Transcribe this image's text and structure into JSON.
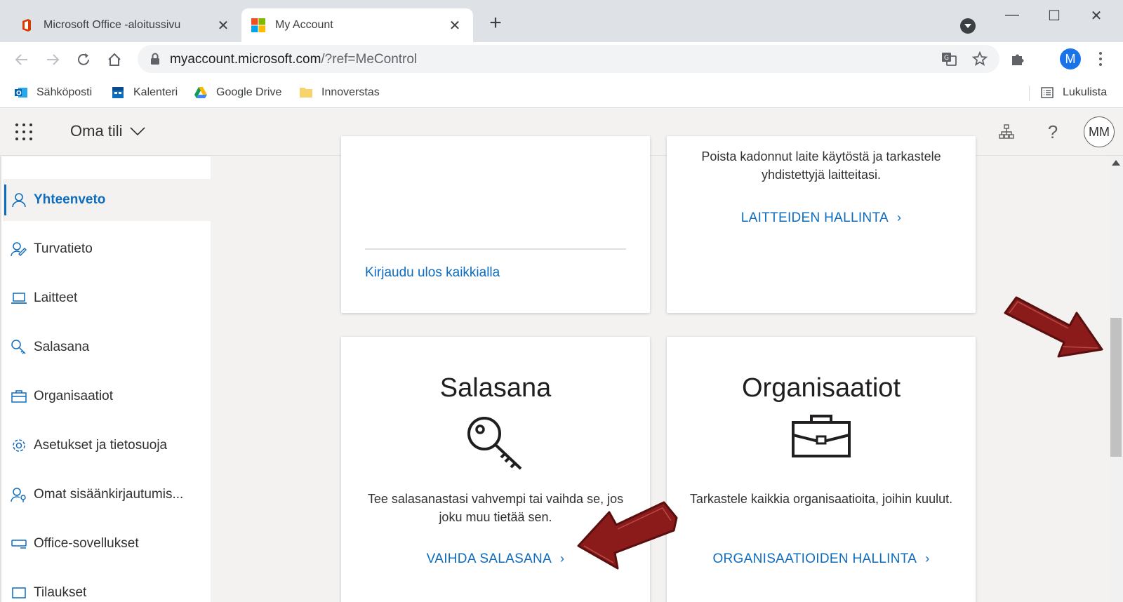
{
  "browser": {
    "tabs": [
      {
        "title": "Microsoft Office -aloitussivu",
        "active": false
      },
      {
        "title": "My Account",
        "active": true
      }
    ],
    "url_host": "myaccount.microsoft.com",
    "url_rest": "/?ref=MeControl",
    "profile_initial": "M",
    "bookmarks": [
      {
        "label": "Sähköposti",
        "icon": "outlook-icon"
      },
      {
        "label": "Kalenteri",
        "icon": "calendar-icon"
      },
      {
        "label": "Google Drive",
        "icon": "google-drive-icon"
      },
      {
        "label": "Innoverstas",
        "icon": "folder-icon"
      }
    ],
    "reading_list": "Lukulista"
  },
  "header": {
    "app_title": "Oma tili",
    "avatar_initials": "MM"
  },
  "sidebar": {
    "items": [
      {
        "label": "Yhteenveto",
        "icon": "person-icon",
        "selected": true
      },
      {
        "label": "Turvatieto",
        "icon": "security-info-icon"
      },
      {
        "label": "Laitteet",
        "icon": "laptop-icon"
      },
      {
        "label": "Salasana",
        "icon": "key-icon"
      },
      {
        "label": "Organisaatiot",
        "icon": "briefcase-icon"
      },
      {
        "label": "Asetukset ja tietosuoja",
        "icon": "gear-icon"
      },
      {
        "label": "Omat sisäänkirjautumis...",
        "icon": "sign-ins-icon"
      },
      {
        "label": "Office-sovellukset",
        "icon": "office-apps-icon"
      },
      {
        "label": "Tilaukset",
        "icon": "subscriptions-icon"
      }
    ]
  },
  "cards": {
    "signout": {
      "link": "Kirjaudu ulos kaikkialla"
    },
    "devices": {
      "desc": "Poista kadonnut laite käytöstä ja tarkastele yhdistettyjä laitteitasi.",
      "link": "LAITTEIDEN HALLINTA"
    },
    "password": {
      "title": "Salasana",
      "desc": "Tee salasanastasi vahvempi tai vaihda se, jos joku muu tietää sen.",
      "link": "VAIHDA SALASANA"
    },
    "organizations": {
      "title": "Organisaatiot",
      "desc": "Tarkastele kaikkia organisaatioita, joihin kuulut.",
      "link": "ORGANISAATIOIDEN HALLINTA"
    }
  },
  "colors": {
    "accent": "#0f6cbd",
    "annotation_arrow": "#8b1a1a"
  }
}
